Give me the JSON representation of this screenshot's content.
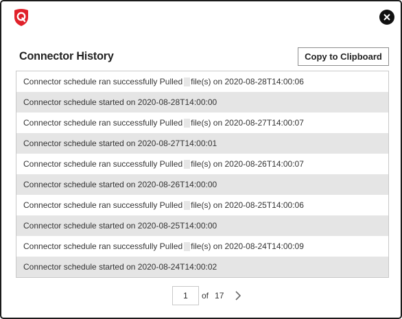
{
  "brand": {
    "logo_letter": "Q",
    "logo_color": "#e0212a",
    "icon": "qualys-shield-logo"
  },
  "dialog": {
    "title": "Connector History",
    "copy_button_label": "Copy to Clipboard",
    "close_icon": "close-icon"
  },
  "history": [
    {
      "prefix": "Connector schedule ran successfully Pulled",
      "suffix": "file(s) on 2020-08-28T14:00:06",
      "count_redacted": true
    },
    {
      "prefix": "Connector schedule started on 2020-08-28T14:00:00",
      "suffix": "",
      "count_redacted": false
    },
    {
      "prefix": "Connector schedule ran successfully Pulled",
      "suffix": "file(s) on 2020-08-27T14:00:07",
      "count_redacted": true
    },
    {
      "prefix": "Connector schedule started on 2020-08-27T14:00:01",
      "suffix": "",
      "count_redacted": false
    },
    {
      "prefix": "Connector schedule ran successfully Pulled",
      "suffix": "file(s) on 2020-08-26T14:00:07",
      "count_redacted": true
    },
    {
      "prefix": "Connector schedule started on 2020-08-26T14:00:00",
      "suffix": "",
      "count_redacted": false
    },
    {
      "prefix": "Connector schedule ran successfully Pulled",
      "suffix": "file(s) on 2020-08-25T14:00:06",
      "count_redacted": true
    },
    {
      "prefix": "Connector schedule started on 2020-08-25T14:00:00",
      "suffix": "",
      "count_redacted": false
    },
    {
      "prefix": "Connector schedule ran successfully Pulled",
      "suffix": "file(s) on 2020-08-24T14:00:09",
      "count_redacted": true
    },
    {
      "prefix": "Connector schedule started on 2020-08-24T14:00:02",
      "suffix": "",
      "count_redacted": false
    }
  ],
  "pagination": {
    "current_page": "1",
    "of_label": "of",
    "total_pages": "17",
    "next_icon": "chevron-right-icon"
  }
}
